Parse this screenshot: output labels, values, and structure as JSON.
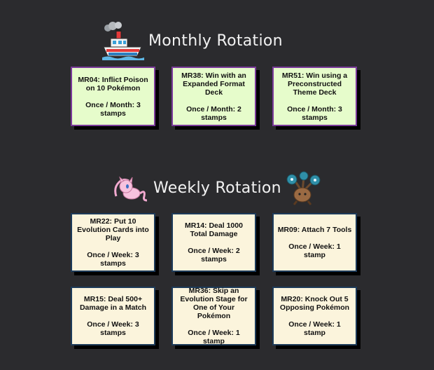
{
  "monthly": {
    "title": "Monthly Rotation",
    "icon": "boat-icon",
    "cards": [
      {
        "title": "MR04: Inflict Poison on 10 Pokémon",
        "freq": "Once / Month: 3 stamps"
      },
      {
        "title": "MR38: Win with an Expanded Format Deck",
        "freq": "Once / Month: 2 stamps"
      },
      {
        "title": "MR51: Win using a Preconstructed Theme Deck",
        "freq": "Once / Month: 3 stamps"
      }
    ]
  },
  "weekly": {
    "title": "Weekly Rotation",
    "icons": [
      "mew-icon",
      "tree-pokemon-icon"
    ],
    "cards": [
      {
        "title": "MR22: Put 10 Evolution Cards into Play",
        "freq": "Once / Week: 3 stamps"
      },
      {
        "title": "MR14: Deal 1000 Total Damage",
        "freq": "Once / Week: 2 stamps"
      },
      {
        "title": "MR09: Attach 7 Tools",
        "freq": "Once / Week: 1 stamp"
      },
      {
        "title": "MR15: Deal 500+ Damage in a Match",
        "freq": "Once / Week: 3 stamps"
      },
      {
        "title": "MR36: Skip an Evolution Stage for One of Your Pokémon",
        "freq": "Once / Week: 1 stamp"
      },
      {
        "title": "MR20: Knock Out 5 Opposing Pokémon",
        "freq": "Once / Week: 1 stamp"
      }
    ]
  },
  "colors": {
    "background": "#2b2b2e",
    "monthly_card_bg": "#e6fccb",
    "monthly_card_border": "#7b3b9b",
    "weekly_card_bg": "#fbf4dc",
    "weekly_card_border": "#1d3b5a"
  }
}
